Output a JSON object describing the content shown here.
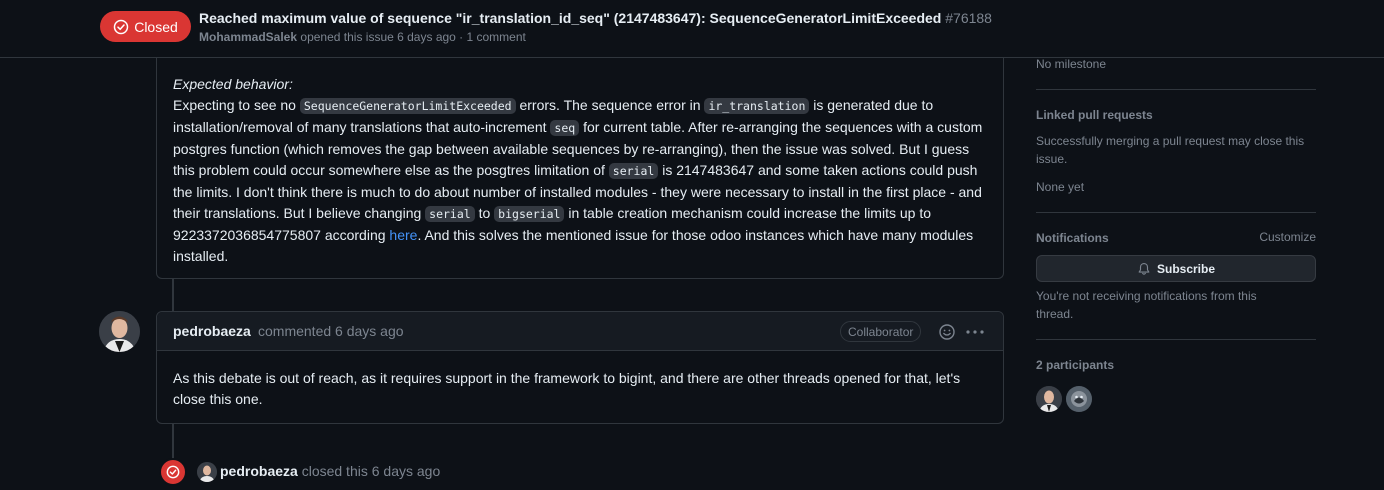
{
  "header": {
    "state": "Closed",
    "title": "Reached maximum value of sequence \"ir_translation_id_seq\" (2147483647): SequenceGeneratorLimitExceeded",
    "number": "#76188",
    "author": "MohammadSalek",
    "meta": "opened this issue 6 days ago · 1 comment"
  },
  "issue_body": {
    "expected_label": "Expected behavior:",
    "t1": "Expecting to see no ",
    "c1": "SequenceGeneratorLimitExceeded",
    "t2": " errors. The sequence error in ",
    "c2": "ir_translation",
    "t3": " is generated due to installation/removal of many translations that auto-increment ",
    "c3": "seq",
    "t4": " for current table. After re-arranging the sequences with a custom postgres function (which removes the gap between available sequences by re-arranging), then the issue was solved. But I guess this problem could occur somewhere else as the posgtres limitation of ",
    "c4": "serial",
    "t5": " is 2147483647 and some taken actions could push the limits. I don't think there is much to do about number of installed modules - they were necessary to install in the first place - and their translations. But I believe changing ",
    "c5": "serial",
    "t6": " to ",
    "c6": "bigserial",
    "t7": " in table creation mechanism could increase the limits up to 9223372036854775807 according ",
    "link": "here",
    "t8": ". And this solves the mentioned issue for those odoo instances which have many modules installed."
  },
  "comment": {
    "author": "pedrobaeza",
    "meta": "commented 6 days ago",
    "badge": "Collaborator",
    "body": "As this debate is out of reach, as it requires support in the framework to bigint, and there are other threads opened for that, let's close this one."
  },
  "closed_event": {
    "author": "pedrobaeza",
    "text": "closed this 6 days ago"
  },
  "sidebar": {
    "milestone": "No milestone",
    "linked_heading": "Linked pull requests",
    "linked_desc": "Successfully merging a pull request may close this issue.",
    "linked_none": "None yet",
    "notifications_heading": "Notifications",
    "customize": "Customize",
    "subscribe": "Subscribe",
    "notif_desc": "You're not receiving notifications from this thread.",
    "participants_heading": "2 participants"
  },
  "colors": {
    "closed_red": "#da3633",
    "link_blue": "#4493f8",
    "background": "#0d1117",
    "border": "#30363d"
  },
  "icons": [
    "closed-circle-icon",
    "smiley-icon",
    "kebab-icon",
    "bell-icon"
  ]
}
